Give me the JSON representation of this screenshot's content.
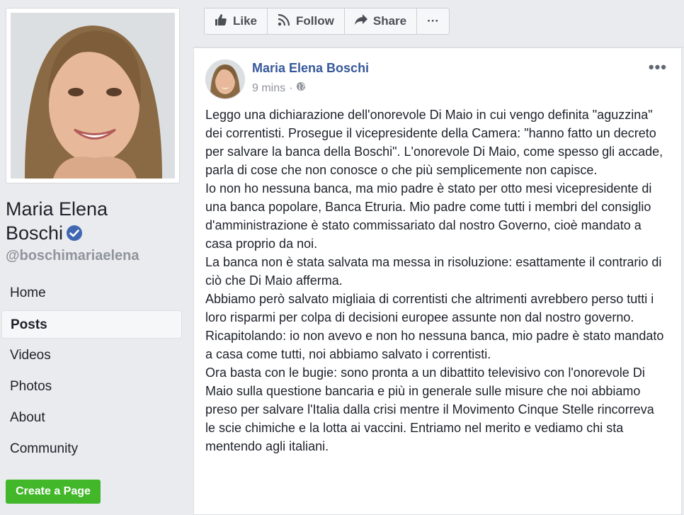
{
  "sidebar": {
    "page_name_line1": "Maria Elena",
    "page_name_line2": "Boschi",
    "handle": "@boschimariaelena",
    "nav": [
      {
        "label": "Home"
      },
      {
        "label": "Posts"
      },
      {
        "label": "Videos"
      },
      {
        "label": "Photos"
      },
      {
        "label": "About"
      },
      {
        "label": "Community"
      }
    ],
    "create_page_label": "Create a Page"
  },
  "action_bar": {
    "like_label": "Like",
    "follow_label": "Follow",
    "share_label": "Share",
    "more_label": "···"
  },
  "post": {
    "author": "Maria Elena Boschi",
    "time": "9 mins",
    "separator": "·",
    "more_label": "•••",
    "paragraphs": [
      "Leggo una dichiarazione dell'onorevole Di Maio in cui vengo definita \"aguzzina\" dei correntisti. Prosegue il vicepresidente della Camera: \"hanno fatto un decreto per salvare la banca della Boschi\". L'onorevole Di Maio, come spesso gli accade, parla di cose che non conosce o che più semplicemente non capisce.",
      "Io non ho nessuna banca, ma mio padre è stato per otto mesi vicepresidente di una banca popolare, Banca Etruria. Mio padre come tutti i membri del consiglio d'amministrazione è stato commissariato dal nostro Governo, cioè mandato a casa proprio da noi.",
      "La banca non è stata salvata ma messa in risoluzione: esattamente il contrario di ciò che Di Maio afferma.",
      "Abbiamo però salvato migliaia di correntisti che altrimenti avrebbero perso tutti i loro risparmi per colpa di decisioni europee assunte non dal nostro governo.",
      "Ricapitolando: io non avevo e non ho nessuna banca, mio padre è stato mandato a casa come tutti, noi abbiamo salvato i correntisti.",
      "Ora basta con le bugie: sono pronta a un dibattito televisivo con l'onorevole Di Maio sulla questione bancaria e più in generale sulle misure che noi abbiamo preso per salvare l'Italia dalla crisi mentre il Movimento Cinque Stelle rincorreva le scie chimiche e la lotta ai vaccini. Entriamo nel merito e vediamo chi sta mentendo agli italiani."
    ]
  },
  "icons": {
    "verified": "verified-badge-icon",
    "like": "thumbs-up-icon",
    "follow": "rss-icon",
    "share": "share-arrow-icon",
    "privacy": "globe-icon"
  },
  "colors": {
    "link_blue": "#365899",
    "create_green": "#42b72a",
    "verified_blue": "#4267b2",
    "background": "#e9ebee"
  }
}
